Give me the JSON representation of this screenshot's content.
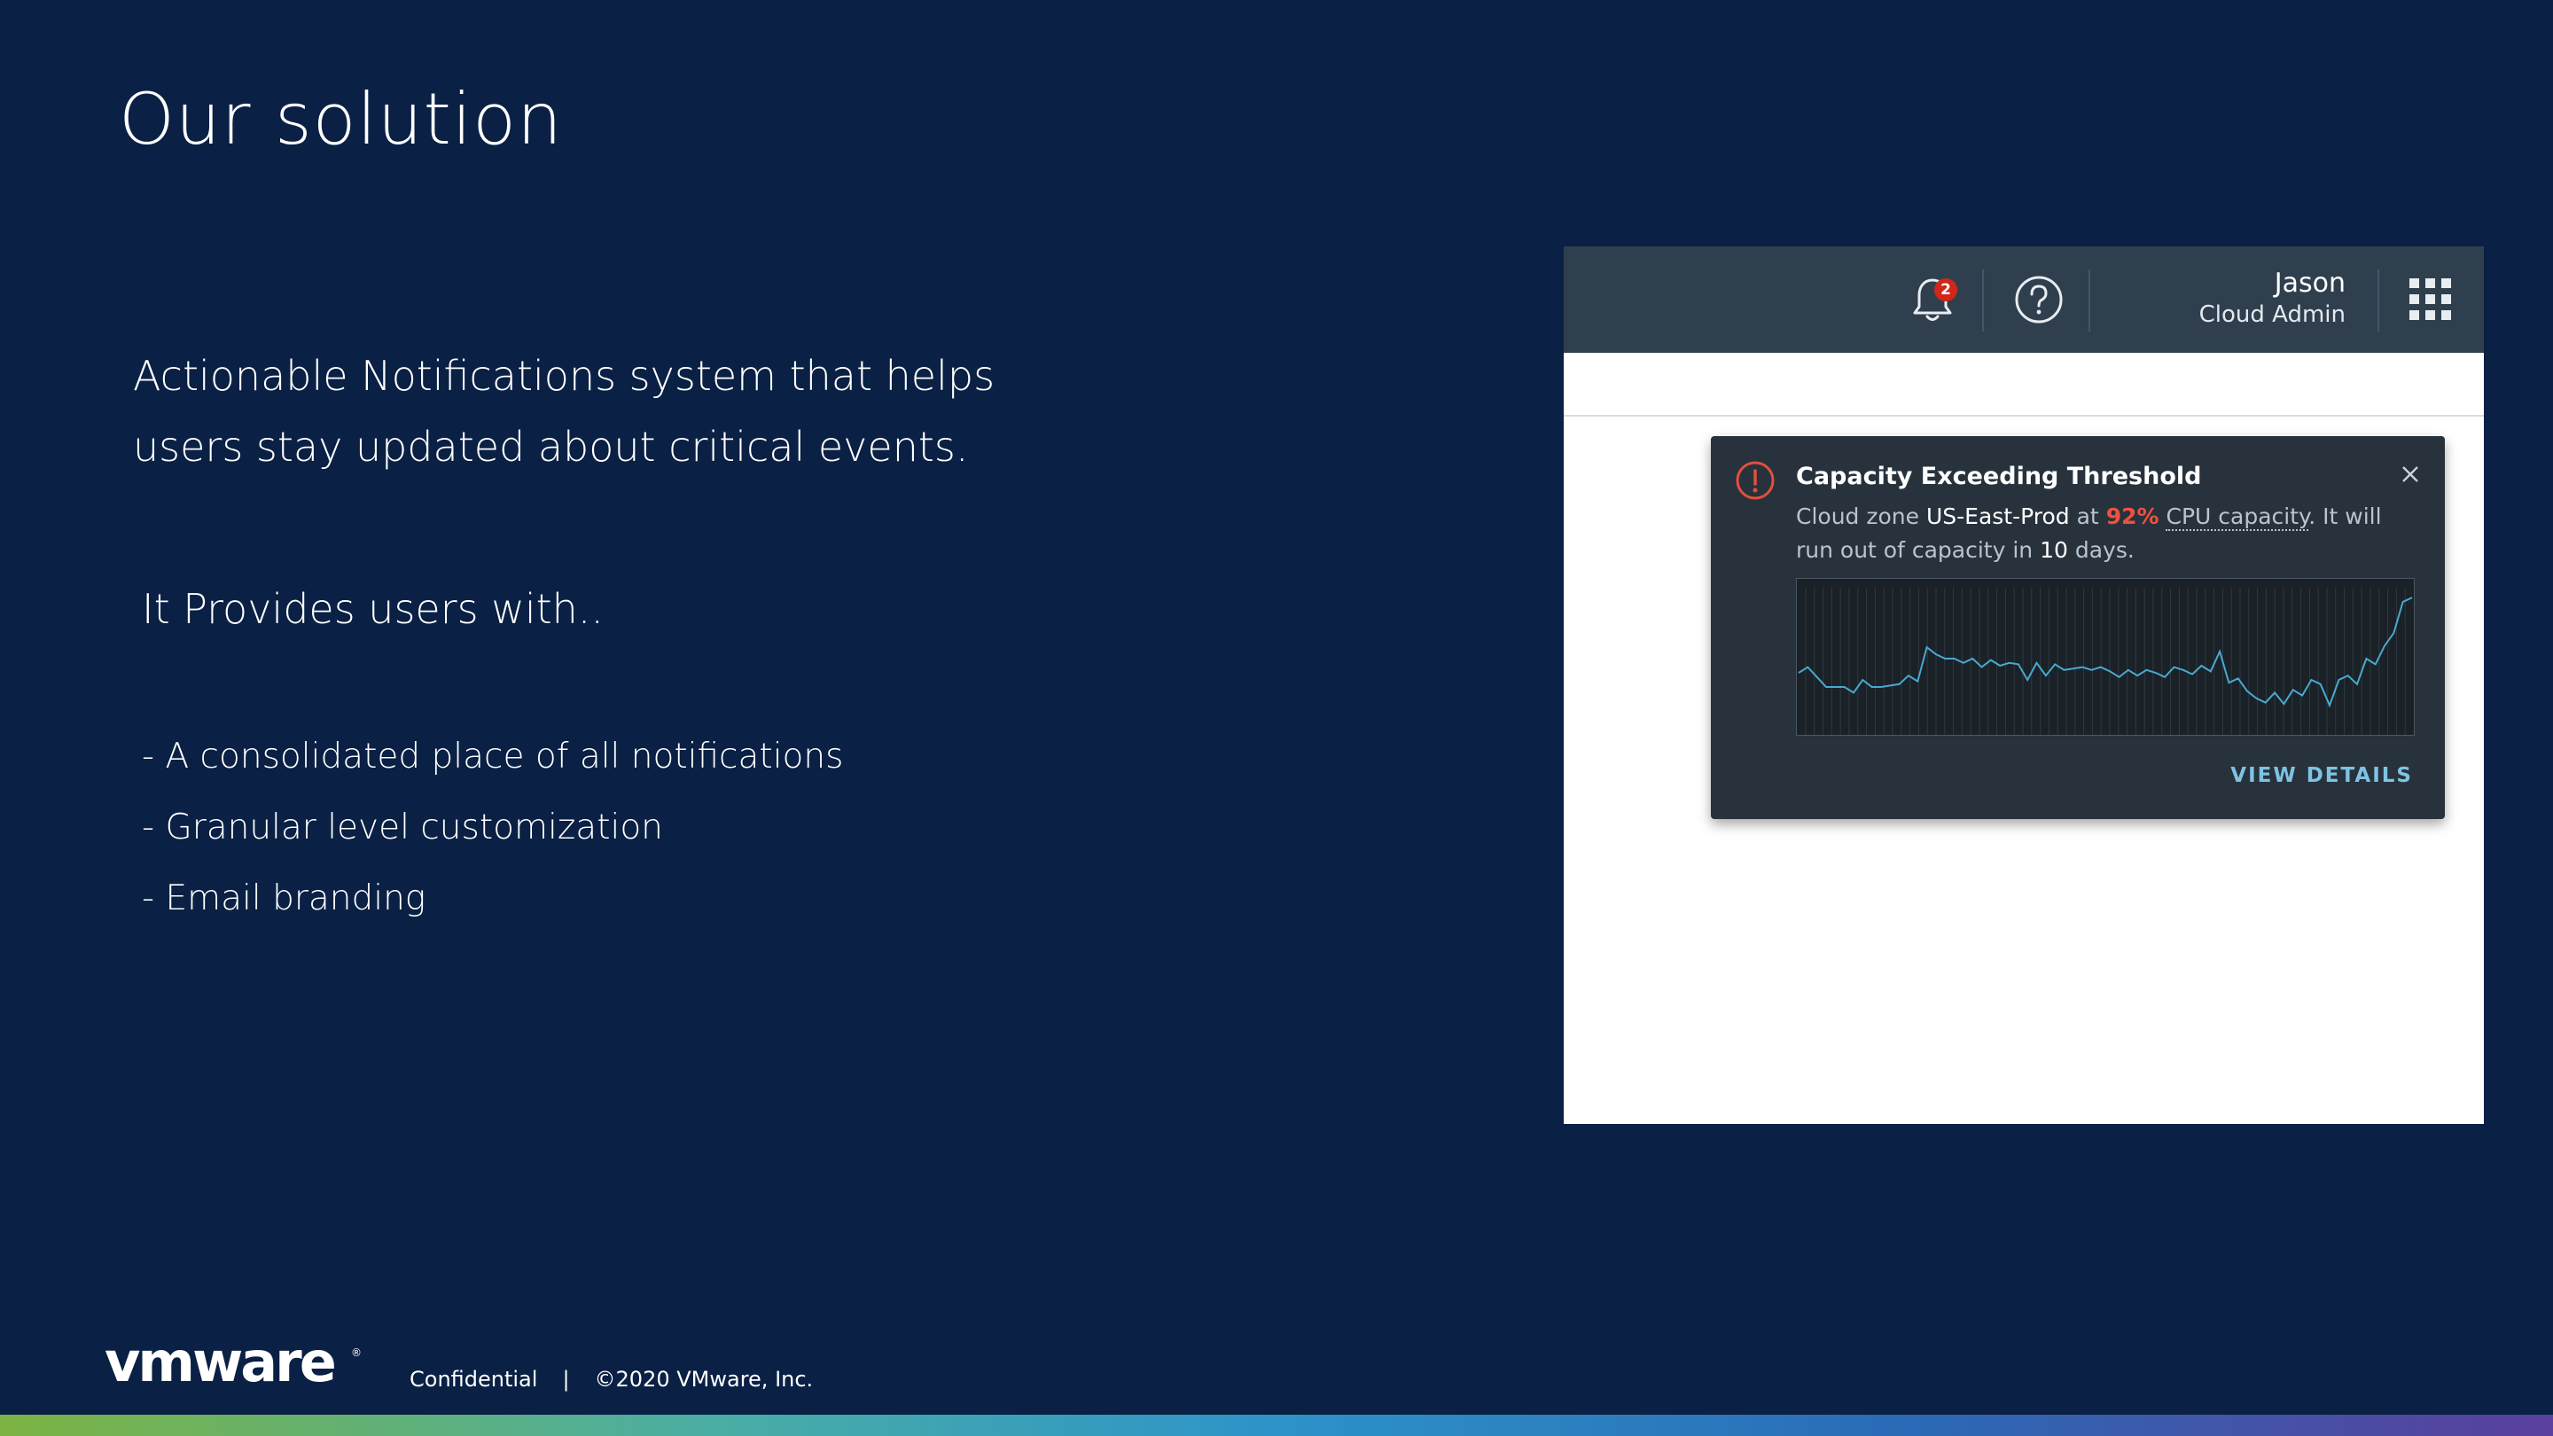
{
  "slide": {
    "title": "Our solution",
    "intro_line1": "Actionable Notifications system that helps",
    "intro_line2": "users stay updated about critical events.",
    "provides": "It Provides users with..",
    "bullets": [
      "- A consolidated place of all notifications",
      "- Granular level customization",
      "- Email branding"
    ]
  },
  "mockup": {
    "header": {
      "notification_count": "2",
      "user_name": "Jason",
      "user_role": "Cloud Admin",
      "icons": [
        "bell-icon",
        "help-icon",
        "apps-grid-icon"
      ]
    },
    "toast": {
      "title": "Capacity Exceeding Threshold",
      "body_prefix": "Cloud zone",
      "zone": "US-East-Prod",
      "at": "at",
      "percent": "92%",
      "metric": "CPU capacity",
      "body_mid": ". It will run out of capacity in",
      "days": "10",
      "body_suffix": "days.",
      "action": "VIEW DETAILS",
      "icons": [
        "alert-icon",
        "close-icon"
      ],
      "sparkline_values": [
        0.4,
        0.44,
        0.37,
        0.3,
        0.3,
        0.3,
        0.26,
        0.35,
        0.3,
        0.3,
        0.31,
        0.32,
        0.38,
        0.34,
        0.58,
        0.53,
        0.5,
        0.5,
        0.47,
        0.5,
        0.44,
        0.49,
        0.45,
        0.47,
        0.46,
        0.35,
        0.47,
        0.38,
        0.46,
        0.42,
        0.43,
        0.44,
        0.42,
        0.44,
        0.41,
        0.37,
        0.42,
        0.38,
        0.42,
        0.4,
        0.37,
        0.44,
        0.42,
        0.39,
        0.45,
        0.41,
        0.55,
        0.33,
        0.36,
        0.27,
        0.22,
        0.19,
        0.26,
        0.18,
        0.28,
        0.24,
        0.35,
        0.32,
        0.17,
        0.35,
        0.38,
        0.32,
        0.5,
        0.46,
        0.59,
        0.68,
        0.9,
        0.93
      ],
      "colors": {
        "alert": "#e0503e",
        "percent": "#f05040",
        "line": "#4aa9cf",
        "action": "#7ec3e3"
      }
    }
  },
  "footer": {
    "logo_text": "vmware",
    "confidential": "Confidential",
    "separator": "|",
    "copyright": "©2020 VMware, Inc."
  }
}
